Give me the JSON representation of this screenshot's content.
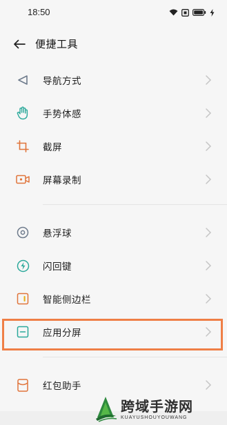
{
  "status_bar": {
    "time": "18:50",
    "icons": [
      "wifi-icon",
      "screen-icon",
      "battery-icon",
      "charging-icon"
    ]
  },
  "header": {
    "title": "便捷工具",
    "back_icon": "back-arrow-icon"
  },
  "section1": [
    {
      "label": "导航方式",
      "icon": "navigation-icon"
    },
    {
      "label": "手势体感",
      "icon": "gesture-icon"
    },
    {
      "label": "截屏",
      "icon": "crop-icon"
    },
    {
      "label": "屏幕录制",
      "icon": "screen-record-icon"
    }
  ],
  "section2": [
    {
      "label": "悬浮球",
      "icon": "floating-ball-icon"
    },
    {
      "label": "闪回键",
      "icon": "flashback-key-icon"
    },
    {
      "label": "智能侧边栏",
      "icon": "smart-sidebar-icon"
    },
    {
      "label": "应用分屏",
      "icon": "split-screen-icon"
    }
  ],
  "section3": [
    {
      "label": "红包助手",
      "icon": "red-packet-icon"
    }
  ],
  "watermark": {
    "name_cn": "跨域手游网",
    "name_en": "KUAYUSHOUYOUWANG"
  },
  "colors": {
    "accent_teal": "#2aa89a",
    "accent_orange": "#e0743a",
    "highlight_border": "#ef7f46",
    "icon_gray": "#6e7b8c"
  }
}
